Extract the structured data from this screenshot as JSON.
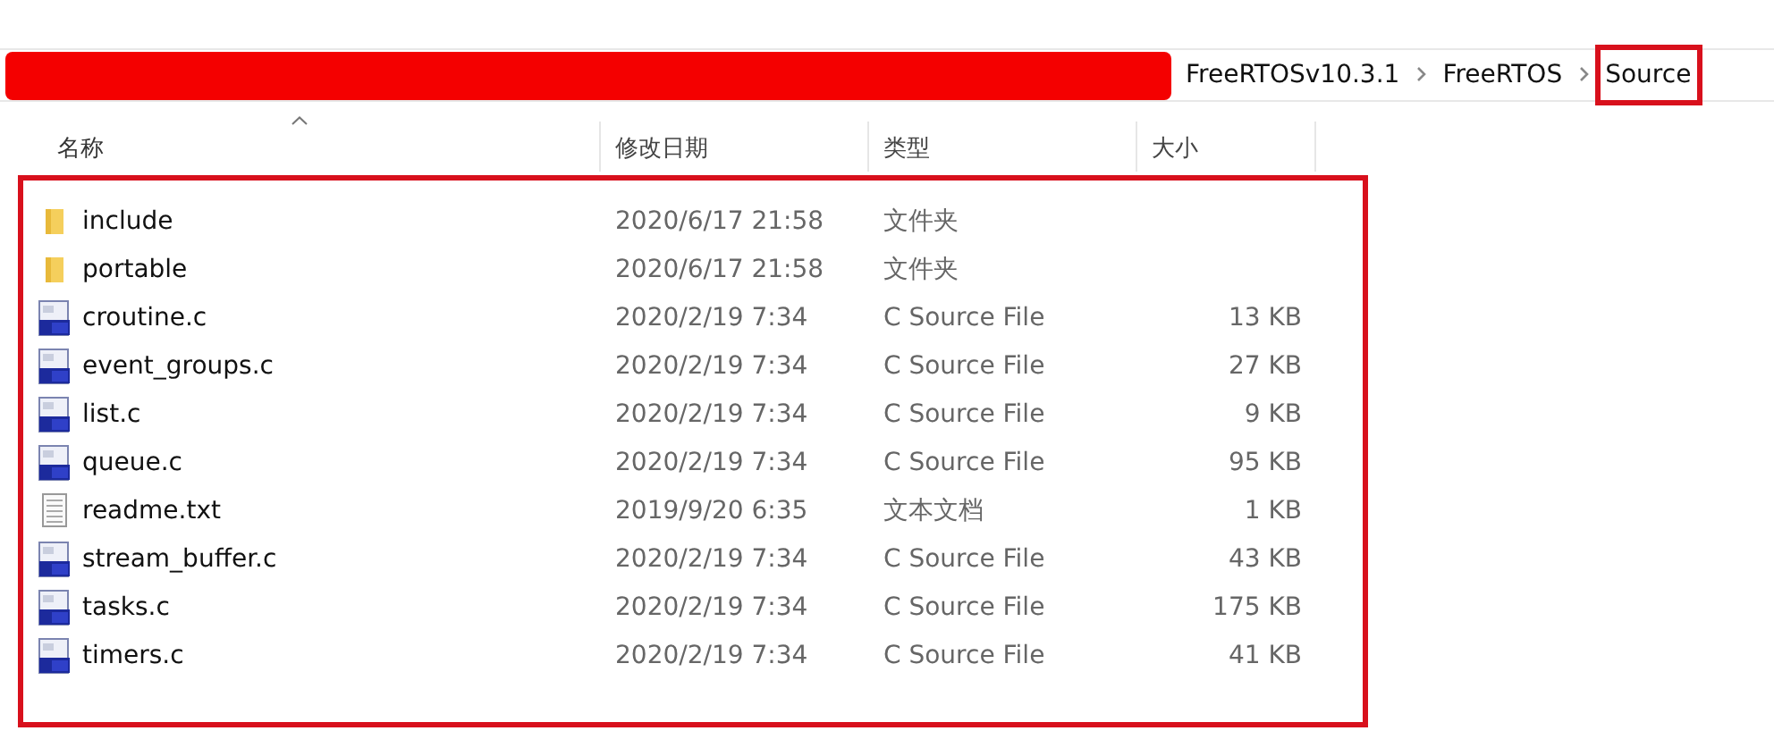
{
  "breadcrumb": [
    "FreeRTOSv10.3.1",
    "FreeRTOS",
    "Source"
  ],
  "columns": [
    {
      "label": "名称",
      "sorted": true
    },
    {
      "label": "修改日期",
      "sorted": false
    },
    {
      "label": "类型",
      "sorted": false
    },
    {
      "label": "大小",
      "sorted": false
    }
  ],
  "files": [
    {
      "kind": "folder",
      "name": "include",
      "modified": "2020/6/17 21:58",
      "type": "文件夹"
    },
    {
      "kind": "folder",
      "name": "portable",
      "modified": "2020/6/17 21:58",
      "type": "文件夹"
    },
    {
      "kind": "c",
      "name": "croutine.c",
      "modified": "2020/2/19 7:34",
      "type": "C Source File",
      "size": "13 KB"
    },
    {
      "kind": "c",
      "name": "event_groups.c",
      "modified": "2020/2/19 7:34",
      "type": "C Source File",
      "size": "27 KB"
    },
    {
      "kind": "c",
      "name": "list.c",
      "modified": "2020/2/19 7:34",
      "type": "C Source File",
      "size": "9 KB"
    },
    {
      "kind": "c",
      "name": "queue.c",
      "modified": "2020/2/19 7:34",
      "type": "C Source File",
      "size": "95 KB"
    },
    {
      "kind": "text",
      "name": "readme.txt",
      "modified": "2019/9/20 6:35",
      "type": "文本文档",
      "size": "1 KB"
    },
    {
      "kind": "c",
      "name": "stream_buffer.c",
      "modified": "2020/2/19 7:34",
      "type": "C Source File",
      "size": "43 KB"
    },
    {
      "kind": "c",
      "name": "tasks.c",
      "modified": "2020/2/19 7:34",
      "type": "C Source File",
      "size": "175 KB"
    },
    {
      "kind": "c",
      "name": "timers.c",
      "modified": "2020/2/19 7:34",
      "type": "C Source File",
      "size": "41 KB"
    }
  ]
}
